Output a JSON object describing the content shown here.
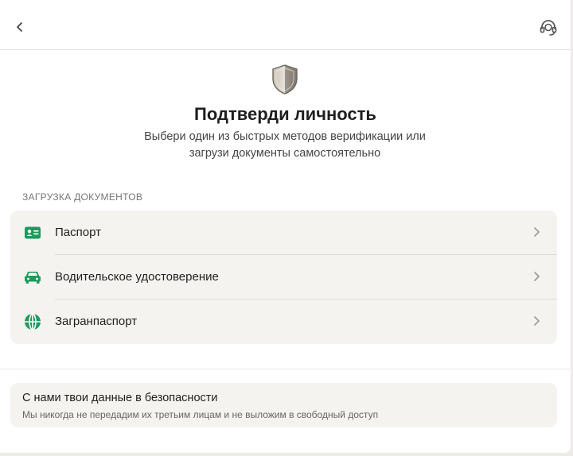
{
  "topbar": {
    "back_icon": "chevron-left-icon",
    "support_icon": "headset-support-icon"
  },
  "hero": {
    "icon": "shield-icon",
    "title": "Подтверди личность",
    "subtitle": "Выбери один из быстрых методов верификации или загрузи документы самостоятельно"
  },
  "documents": {
    "section_label": "ЗАГРУЗКА ДОКУМЕНТОВ",
    "items": [
      {
        "label": "Паспорт",
        "icon": "id-card-icon"
      },
      {
        "label": "Водительское удостоверение",
        "icon": "car-icon"
      },
      {
        "label": "Загранпаспорт",
        "icon": "globe-icon"
      }
    ]
  },
  "security": {
    "title": "С нами твои данные в безопасности",
    "text": "Мы никогда не передадим их третьим лицам и не выложим в свободный доступ"
  },
  "colors": {
    "accent_green": "#1f9a5c",
    "card_bg": "#f4f3ef",
    "page_bg": "#ffffff"
  }
}
